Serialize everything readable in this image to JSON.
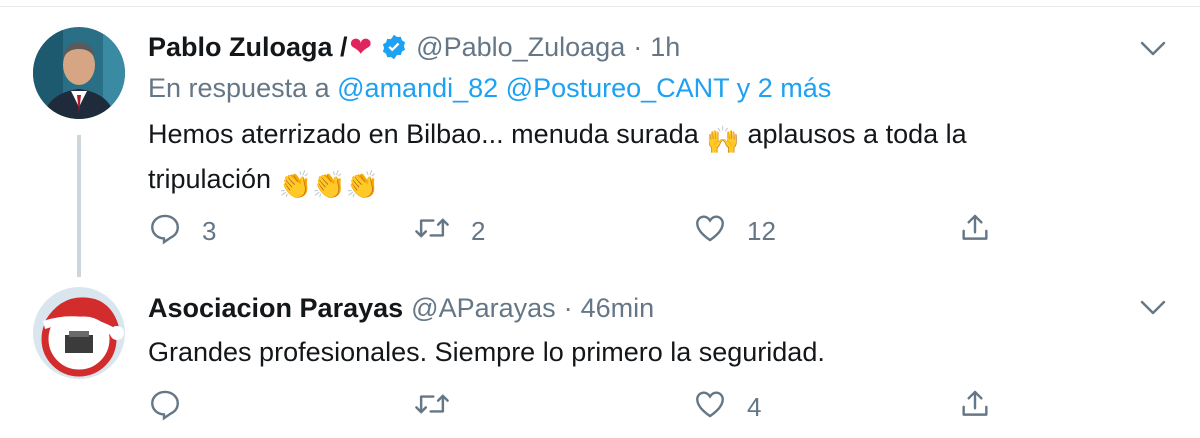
{
  "tweets": [
    {
      "author_name": "Pablo Zuloaga /",
      "author_emoji": "❤",
      "handle": "@Pablo_Zuloaga",
      "separator": "·",
      "time": "1h",
      "reply": {
        "prefix": "En respuesta a",
        "mention1": "@amandi_82",
        "mention2": "@Postureo_CANT",
        "more": "y 2 más"
      },
      "text_line1": "Hemos aterrizado en Bilbao... menuda surada",
      "emoji_raise": "🙌",
      "text_line1b": "aplausos a toda la",
      "text_line2": "tripulación",
      "emoji_clap": "👏👏👏",
      "reply_count": "3",
      "retweet_count": "2",
      "like_count": "12"
    },
    {
      "author_name": "Asociacion Parayas",
      "handle": "@AParayas",
      "separator": "·",
      "time": "46min",
      "text": "Grandes profesionales. Siempre lo primero la seguridad.",
      "reply_count": "",
      "retweet_count": "",
      "like_count": "4"
    }
  ],
  "colors": {
    "accent": "#1da1f2",
    "muted": "#657786",
    "text": "#14171a",
    "heart": "#e0245e"
  }
}
